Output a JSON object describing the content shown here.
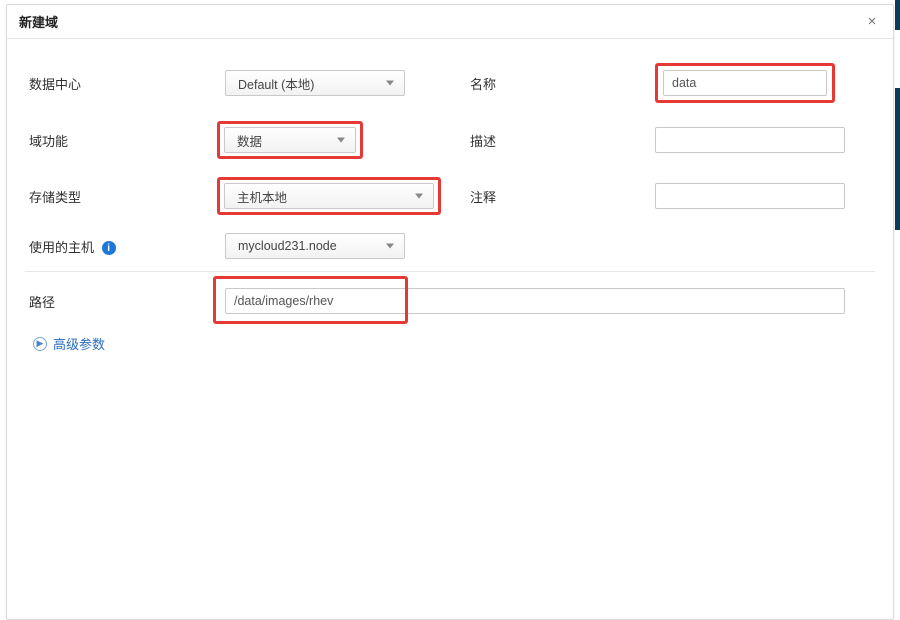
{
  "dialog": {
    "title": "新建域"
  },
  "labels": {
    "data_center": "数据中心",
    "domain_function": "域功能",
    "storage_type": "存储类型",
    "used_host": "使用的主机",
    "name": "名称",
    "description": "描述",
    "comment": "注释",
    "path": "路径",
    "advanced": "高级参数"
  },
  "fields": {
    "data_center_value": "Default (本地)",
    "domain_function_value": "数据",
    "storage_type_value": "主机本地",
    "used_host_value": "mycloud231.node",
    "name_value": "data",
    "description_value": "",
    "comment_value": "",
    "path_value": "/data/images/rhev"
  },
  "icons": {
    "info": "i"
  }
}
